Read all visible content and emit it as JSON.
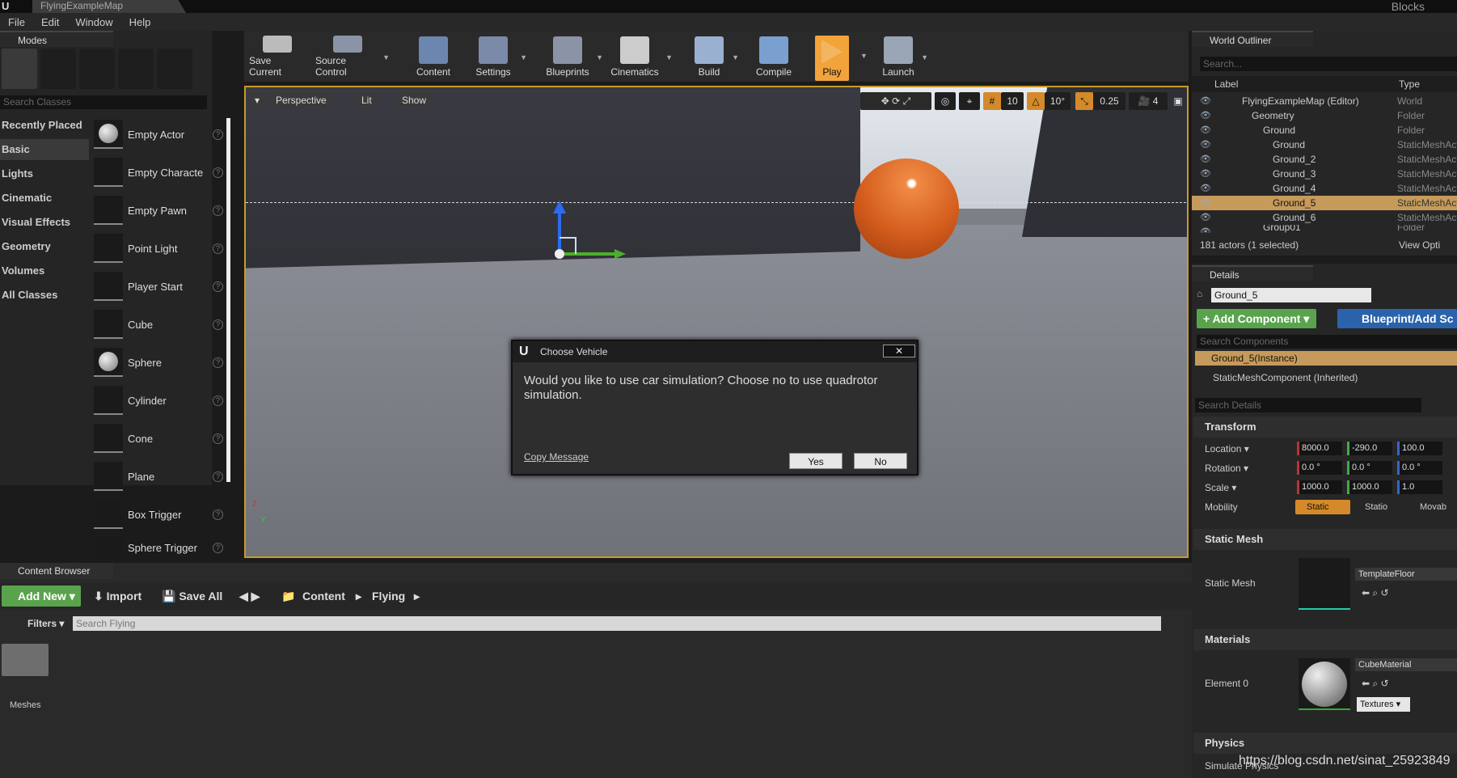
{
  "window": {
    "tab_title": "FlyingExampleMap",
    "project": "Blocks"
  },
  "menu": [
    "File",
    "Edit",
    "Window",
    "Help"
  ],
  "modes": {
    "tab": "Modes",
    "search_placeholder": "Search Classes",
    "categories": [
      "Recently Placed",
      "Basic",
      "Lights",
      "Cinematic",
      "Visual Effects",
      "Geometry",
      "Volumes",
      "All Classes"
    ],
    "items": [
      "Empty Actor",
      "Empty Characte",
      "Empty Pawn",
      "Point Light",
      "Player Start",
      "Cube",
      "Sphere",
      "Cylinder",
      "Cone",
      "Plane",
      "Box Trigger",
      "Sphere Trigger"
    ]
  },
  "toolbar": {
    "save_current": "Save Current",
    "source_control": "Source Control",
    "content": "Content",
    "settings": "Settings",
    "blueprints": "Blueprints",
    "cinematics": "Cinematics",
    "build": "Build",
    "compile": "Compile",
    "play": "Play",
    "launch": "Launch"
  },
  "viewport": {
    "perspective": "Perspective",
    "lit": "Lit",
    "show": "Show",
    "grid_snap": "10",
    "rot_snap": "10°",
    "scale_snap": "0.25",
    "cam_speed": "4"
  },
  "dialog": {
    "title": "Choose Vehicle",
    "message": "Would you like to use car simulation? Choose no to use quadrotor simulation.",
    "copy": "Copy Message",
    "yes": "Yes",
    "no": "No",
    "close": "✕"
  },
  "outliner": {
    "tab": "World Outliner",
    "search_placeholder": "Search...",
    "col_label": "Label",
    "col_type": "Type",
    "rows": [
      {
        "label": "FlyingExampleMap (Editor)",
        "type": "World"
      },
      {
        "label": "Geometry",
        "type": "Folder"
      },
      {
        "label": "Ground",
        "type": "Folder"
      },
      {
        "label": "Ground",
        "type": "StaticMeshActor"
      },
      {
        "label": "Ground_2",
        "type": "StaticMeshActor"
      },
      {
        "label": "Ground_3",
        "type": "StaticMeshActor"
      },
      {
        "label": "Ground_4",
        "type": "StaticMeshActor"
      },
      {
        "label": "Ground_5",
        "type": "StaticMeshActor"
      },
      {
        "label": "Ground_6",
        "type": "StaticMeshActor"
      },
      {
        "label": "Group01",
        "type": "Folder"
      }
    ],
    "count": "181 actors (1 selected)",
    "view_options": "View Opti"
  },
  "details": {
    "tab": "Details",
    "name": "Ground_5",
    "add_component": "+ Add Component ▾",
    "blueprint": "Blueprint/Add Sc",
    "search_components": "Search Components",
    "instance": "Ground_5(Instance)",
    "component": "StaticMeshComponent (Inherited)",
    "search_details": "Search Details",
    "transform": "Transform",
    "location_label": "Location ▾",
    "location": [
      "8000.0",
      "-290.0",
      "100.0"
    ],
    "rotation_label": "Rotation ▾",
    "rotation": [
      "0.0 °",
      "0.0 °",
      "0.0 °"
    ],
    "scale_label": "Scale ▾",
    "scale": [
      "1000.0",
      "1000.0",
      "1.0"
    ],
    "mobility_label": "Mobility",
    "mobility": [
      "Static",
      "Statio",
      "Movab"
    ],
    "static_mesh_sec": "Static Mesh",
    "static_mesh_label": "Static Mesh",
    "static_mesh": "TemplateFloor",
    "materials_sec": "Materials",
    "element0_label": "Element 0",
    "material": "CubeMaterial",
    "textures": "Textures ▾",
    "physics_sec": "Physics",
    "simulate": "Simulate Physics"
  },
  "content_browser": {
    "tab": "Content Browser",
    "add_new": "Add New ▾",
    "import": "Import",
    "save_all": "Save All",
    "path": [
      "Content",
      "Flying"
    ],
    "filters": "Filters ▾",
    "search_placeholder": "Search Flying",
    "folder": "Meshes"
  },
  "watermark": "https://blog.csdn.net/sinat_25923849"
}
